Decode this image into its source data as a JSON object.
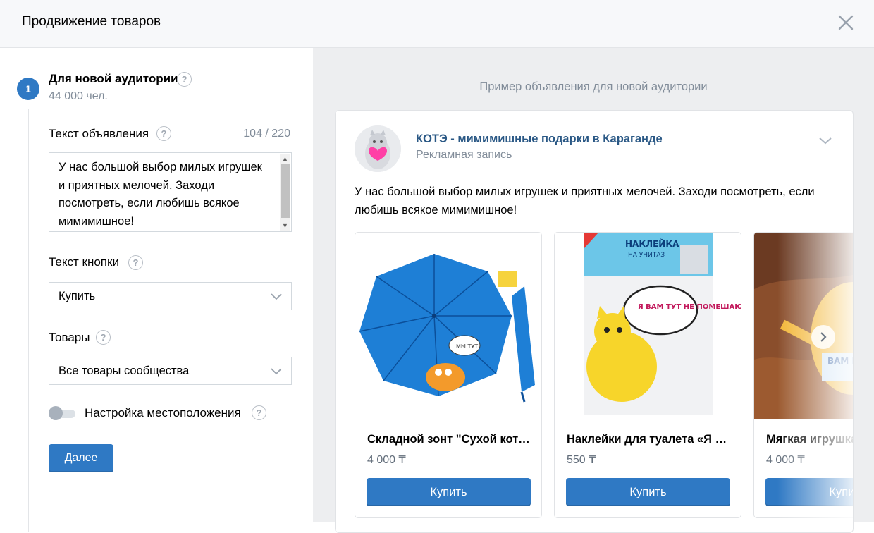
{
  "header": {
    "title": "Продвижение товаров"
  },
  "audience": {
    "step_number": "1",
    "title": "Для новой аудитории",
    "count": "44 000 чел."
  },
  "ad_text": {
    "label": "Текст объявления",
    "counter": "104 / 220",
    "value": "У нас большой выбор милых игрушек и приятных мелочей. Заходи посмотреть, если любишь всякое мимимишное!"
  },
  "button_text": {
    "label": "Текст кнопки",
    "selected": "Купить"
  },
  "products_field": {
    "label": "Товары",
    "selected": "Все товары сообщества"
  },
  "location": {
    "label": "Настройка местоположения",
    "enabled": false
  },
  "next_button": "Далее",
  "preview": {
    "caption": "Пример объявления для новой аудитории",
    "author": "КОТЭ - мимимишные подарки в Караганде",
    "subtitle": "Рекламная запись",
    "text": "У нас большой выбор милых игрушек и приятных мелочей. Заходи посмотреть, если любишь всякое мимимишное!",
    "products": [
      {
        "name": "Складной зонт \"Сухой кот…",
        "price": "4 000 ₸",
        "button": "Купить"
      },
      {
        "name": "Наклейки для туалета «Я …",
        "price": "550 ₸",
        "button": "Купить"
      },
      {
        "name": "Мягкая игрушка",
        "price": "4 000 ₸",
        "button": "Купить"
      }
    ],
    "image_texts": {
      "umbrella_bubble": "МЫ ТУТ",
      "sticker_title": "НАКЛЕЙКА",
      "sticker_sub": "НА УНИТАЗ",
      "sticker_bubble": "Я ВАМ ТУТ НЕ ПОМЕШАЮ?",
      "toy_text": "ВАМ НА ЗАВИРА"
    }
  },
  "colors": {
    "accent": "#2f79c4",
    "link": "#2a5885",
    "muted": "#818c99",
    "panel_bg": "#edeef0"
  },
  "icons": [
    "close-icon",
    "help-icon",
    "chevron-down-icon",
    "chevron-right-icon"
  ]
}
